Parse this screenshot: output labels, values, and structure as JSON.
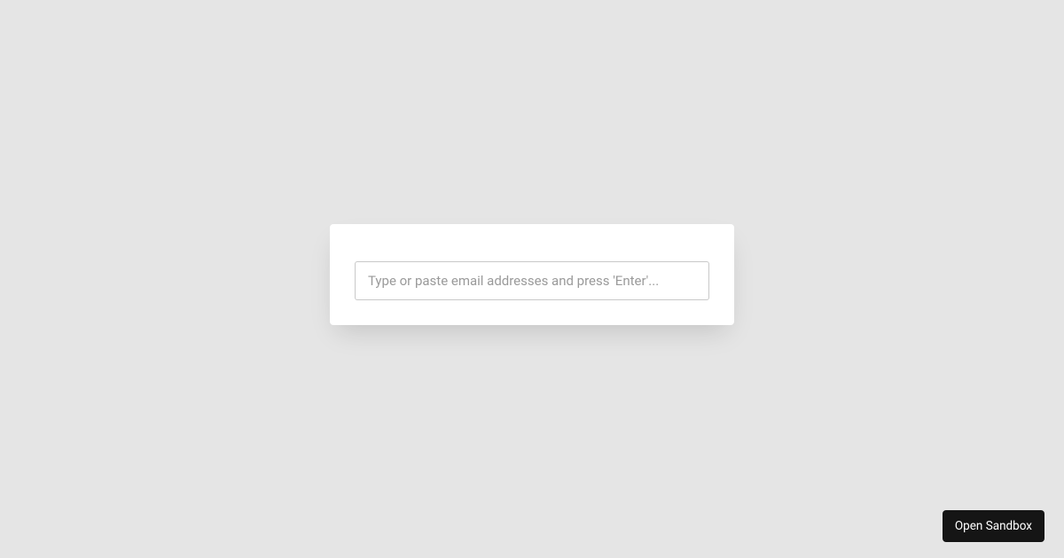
{
  "card": {
    "email_input": {
      "placeholder": "Type or paste email addresses and press 'Enter'...",
      "value": ""
    }
  },
  "footer": {
    "open_sandbox_label": "Open Sandbox"
  }
}
